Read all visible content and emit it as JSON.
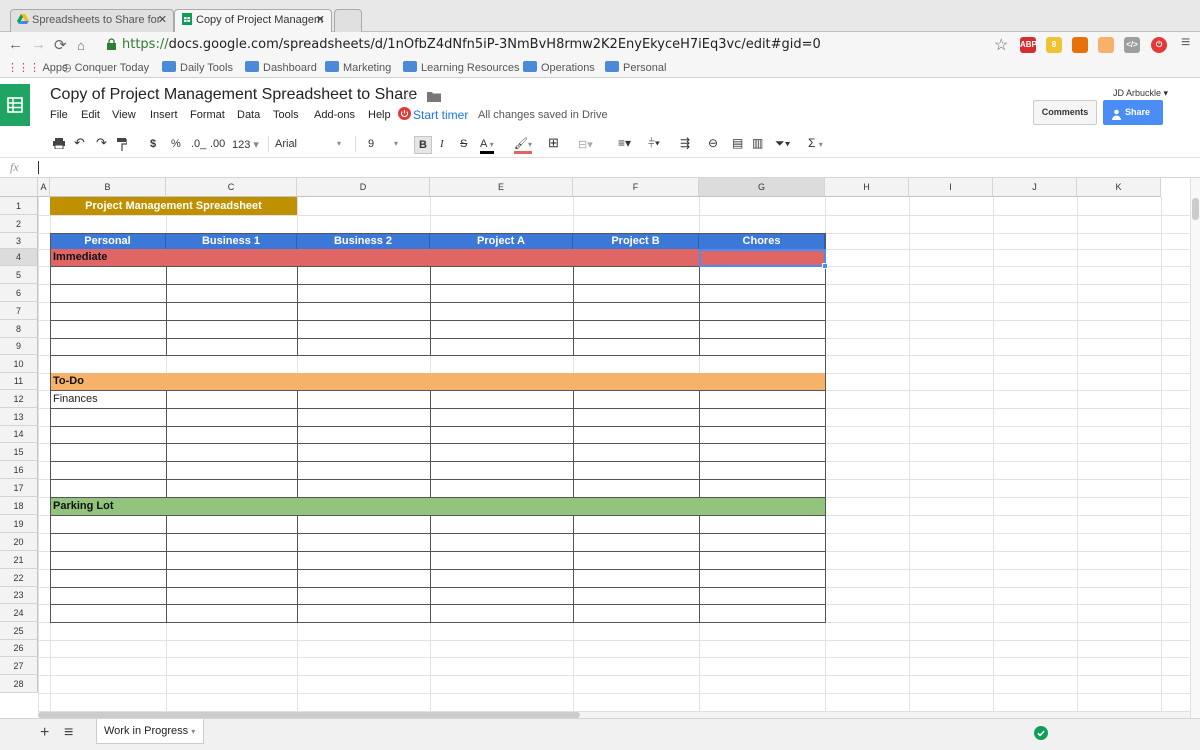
{
  "browser": {
    "tabs": [
      {
        "title": "Spreadsheets to Share for"
      },
      {
        "title": "Copy of Project Managem"
      }
    ],
    "url_scheme": "https://",
    "url_rest": "docs.google.com/spreadsheets/d/1nOfbZ4dNfn5iP-3NmBvH8rmw2K2EnyEkyceH7iEq3vc/edit#gid=0",
    "bookmarks": [
      "Apps",
      "Conquer Today",
      "Daily Tools",
      "Dashboard",
      "Marketing",
      "Learning Resources",
      "Operations",
      "Personal"
    ],
    "extensions": [
      {
        "label": "ABP",
        "color": "#d32f2f"
      },
      {
        "label": "8",
        "color": "#f1c232"
      },
      {
        "label": "",
        "color": "#e8710a"
      },
      {
        "label": "",
        "color": "#f6b26b"
      },
      {
        "label": "</>",
        "color": "#9e9e9e"
      },
      {
        "label": "⏻",
        "color": "#e53935"
      }
    ]
  },
  "doc": {
    "title": "Copy of Project Management Spreadsheet to Share",
    "menus": [
      "File",
      "Edit",
      "View",
      "Insert",
      "Format",
      "Data",
      "Tools",
      "Add-ons",
      "Help"
    ],
    "start_timer": "Start timer",
    "save_status": "All changes saved in Drive",
    "user": "JD Arbuckle",
    "comments_label": "Comments",
    "share_label": "Share"
  },
  "toolbar": {
    "currency": "$",
    "percent": "%",
    "dec_less": ".0_",
    "dec_more": ".00",
    "format_more": "123",
    "font": "Arial",
    "size": "9",
    "bold": "B",
    "italic": "I",
    "strike": "S",
    "textcolor": "A",
    "sigma": "Σ"
  },
  "formula": {
    "fx": "fx",
    "value": ""
  },
  "columns": [
    "A",
    "B",
    "C",
    "D",
    "E",
    "F",
    "G",
    "H",
    "I",
    "J",
    "K"
  ],
  "rows": [
    "1",
    "2",
    "3",
    "4",
    "5",
    "6",
    "7",
    "8",
    "9",
    "10",
    "11",
    "12",
    "13",
    "14",
    "15",
    "16",
    "17",
    "18",
    "19",
    "20",
    "21",
    "22",
    "23",
    "24",
    "25",
    "26",
    "27",
    "28"
  ],
  "sheet": {
    "banner": "Project Management Spreadsheet",
    "headers": [
      "Personal",
      "Business 1",
      "Business 2",
      "Project A",
      "Project B",
      "Chores"
    ],
    "sections": [
      {
        "label": "Immediate",
        "color": "#e06666"
      },
      {
        "label": "To-Do",
        "color": "#f6b26b"
      },
      {
        "label": "Parking Lot",
        "color": "#93c47d"
      }
    ],
    "finances": "Finances",
    "header_color": "#3c78d8",
    "banner_color": "#bf9000"
  },
  "sheet_tab": "Work in Progress"
}
